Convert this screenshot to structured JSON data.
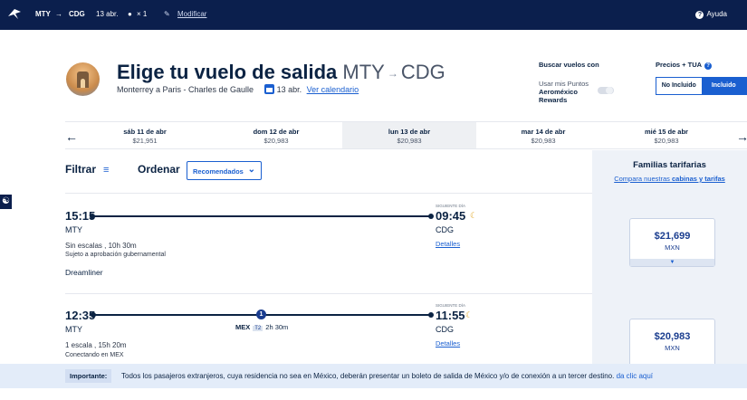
{
  "topbar": {
    "origin": "MTY",
    "arrow": "→",
    "destination": "CDG",
    "date": "13 abr.",
    "passengers": "× 1",
    "modify": "Modificar",
    "help": "Ayuda"
  },
  "header": {
    "title": "Elige tu vuelo de salida",
    "route_from": "MTY",
    "route_arrow": "→",
    "route_to": "CDG",
    "subtitle": "Monterrey a Paris - Charles de Gaulle",
    "date": "13 abr.",
    "calendar_link": "Ver calendario"
  },
  "points": {
    "heading": "Buscar vuelos con",
    "line1": "Usar mis Puntos",
    "line2": "Aeroméxico",
    "line3": "Rewards"
  },
  "prices": {
    "heading": "Precios + TUA",
    "not_included": "No Incluido",
    "included": "Incluido"
  },
  "dates": [
    {
      "day": "sáb 11 de abr",
      "price": "$21,951"
    },
    {
      "day": "dom 12 de abr",
      "price": "$20,983"
    },
    {
      "day": "lun 13 de abr",
      "price": "$20,983"
    },
    {
      "day": "mar 14 de abr",
      "price": "$20,983"
    },
    {
      "day": "mié 15 de abr",
      "price": "$20,983"
    }
  ],
  "toolbar": {
    "filter": "Filtrar",
    "order": "Ordenar",
    "order_value": "Recomendados"
  },
  "fare_panel": {
    "title": "Familias tarifarias",
    "link_prefix": "Compara nuestras ",
    "link_bold": "cabinas y tarifas"
  },
  "flights": [
    {
      "dep_time": "15:15",
      "dep_code": "MTY",
      "arr_time": "09:45",
      "arr_code": "CDG",
      "next_day": "SIGUIENTE DÍA",
      "stops": "Sin escalas , 10h 30m",
      "note": "Sujeto a aprobación gubernamental",
      "aircraft": "Dreamliner",
      "details": "Detalles",
      "price": "$21,699",
      "currency": "MXN"
    },
    {
      "dep_time": "12:35",
      "dep_code": "MTY",
      "arr_time": "11:55",
      "arr_code": "CDG",
      "next_day": "SIGUIENTE DÍA",
      "stops": "1 escala , 15h 20m",
      "note": "Conectando en MEX",
      "stop_count": "1",
      "via_code": "MEX",
      "via_terminal": "T2",
      "via_duration": "2h 30m",
      "details": "Detalles",
      "price": "$20,983",
      "currency": "MXN"
    }
  ],
  "notice": {
    "label": "Importante:",
    "message": "Todos los pasajeros extranjeros, cuya residencia no sea en México, deberán presentar un boleto de salida de México y/o de conexión a un tercer destino.",
    "link": "da clic aquí"
  }
}
